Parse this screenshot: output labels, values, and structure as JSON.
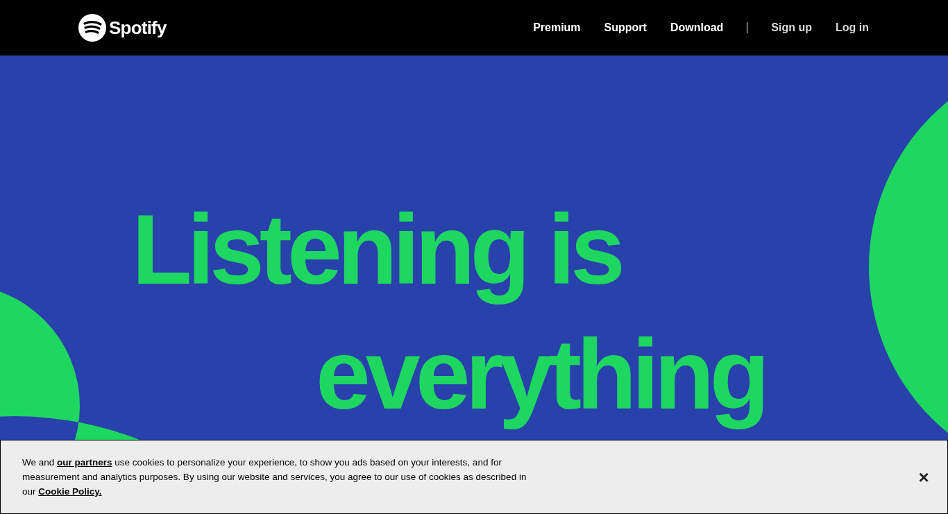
{
  "header": {
    "logo_text": "Spotify",
    "nav": [
      {
        "label": "Premium"
      },
      {
        "label": "Support"
      },
      {
        "label": "Download"
      }
    ],
    "account": [
      {
        "label": "Sign up"
      },
      {
        "label": "Log in"
      }
    ]
  },
  "hero": {
    "lines": [
      "Listening is",
      "everything"
    ]
  },
  "cookie_banner": {
    "text_start": "We and",
    "link_partners": "our partners",
    "text_middle": "use cookies to personalize your experience, to show you ads based on your interests, and for measurement and analytics purposes. By using our website and services, you agree to our use of cookies as described in our",
    "link_policy": "Cookie Policy.",
    "close": "×"
  }
}
